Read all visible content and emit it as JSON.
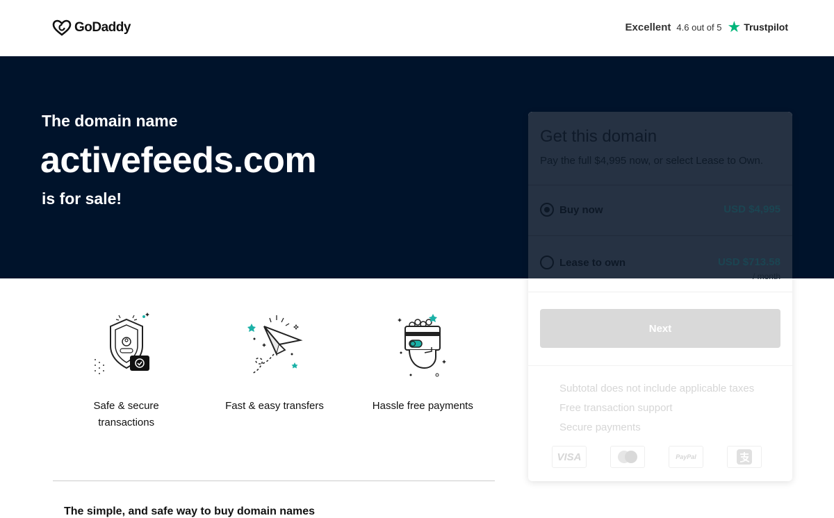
{
  "header": {
    "brand": "GoDaddy",
    "rating_word": "Excellent",
    "rating_score": "4.6 out of 5",
    "rating_star": "★",
    "trustpilot": "Trustpilot"
  },
  "hero": {
    "intro": "The domain name",
    "domain": "activefeeds.com",
    "sale": "is for sale!"
  },
  "features": [
    {
      "label": "Safe & secure transactions",
      "icon": "shield-icon"
    },
    {
      "label": "Fast & easy transfers",
      "icon": "paper-plane-icon"
    },
    {
      "label": "Hassle free payments",
      "icon": "card-hand-icon"
    }
  ],
  "bottom": {
    "heading": "The simple, and safe way to buy domain names"
  },
  "card": {
    "title": "Get this domain",
    "subtitle": "Pay the full $4,995 now, or select Lease to Own.",
    "options": [
      {
        "label": "Buy now",
        "price": "USD $4,995",
        "period": "",
        "selected": true
      },
      {
        "label": "Lease to own",
        "price": "USD $713.58",
        "period": "/ month",
        "selected": false
      }
    ],
    "next_label": "Next",
    "notes": [
      "Subtotal does not include applicable taxes",
      "Free transaction support",
      "Secure payments"
    ],
    "payment_methods": [
      "VISA",
      "Mastercard",
      "PayPal",
      "Alipay"
    ]
  },
  "colors": {
    "hero_bg": "#00132b",
    "accent": "#00b67a",
    "teal": "#1bb1a7"
  }
}
